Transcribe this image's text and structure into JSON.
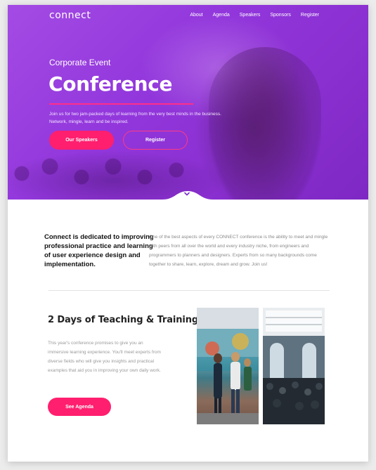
{
  "brand": {
    "logo": "connect"
  },
  "nav": {
    "items": [
      "About",
      "Agenda",
      "Speakers",
      "Sponsors",
      "Register"
    ]
  },
  "hero": {
    "eyebrow": "Corporate Event",
    "title": "Conference",
    "intro": "Join us for two jam-packed days of learning from the very best minds in the business. Network, mingle, learn and be inspired.",
    "primary_button": "Our Speakers",
    "secondary_button": "Register",
    "scroll_icon": "chevron-down-icon"
  },
  "about": {
    "heading": "Connect is dedicated to improving professional practice and learning of user experience design and implementation.",
    "body": "One of the best aspects of every CONNECT conference is the ability to meet and mingle with peers from all over the world and every industry niche, from engineers and programmers to planners and designers. Experts from so many backgrounds come together to share, learn, explore, dream and grow. Join us!"
  },
  "teaching": {
    "title": "2 Days of Teaching & Training",
    "body": "This year's conference promises to give you an immersive learning experience. You'll meet experts from diverse fields who will give you insights and practical examples that aid you in improving your own daily work.",
    "button": "See Agenda"
  },
  "colors": {
    "accent": "#ff1f6e",
    "hero_purple": "#9237dc",
    "text_dark": "#111111",
    "text_muted": "#8a8a8a"
  }
}
